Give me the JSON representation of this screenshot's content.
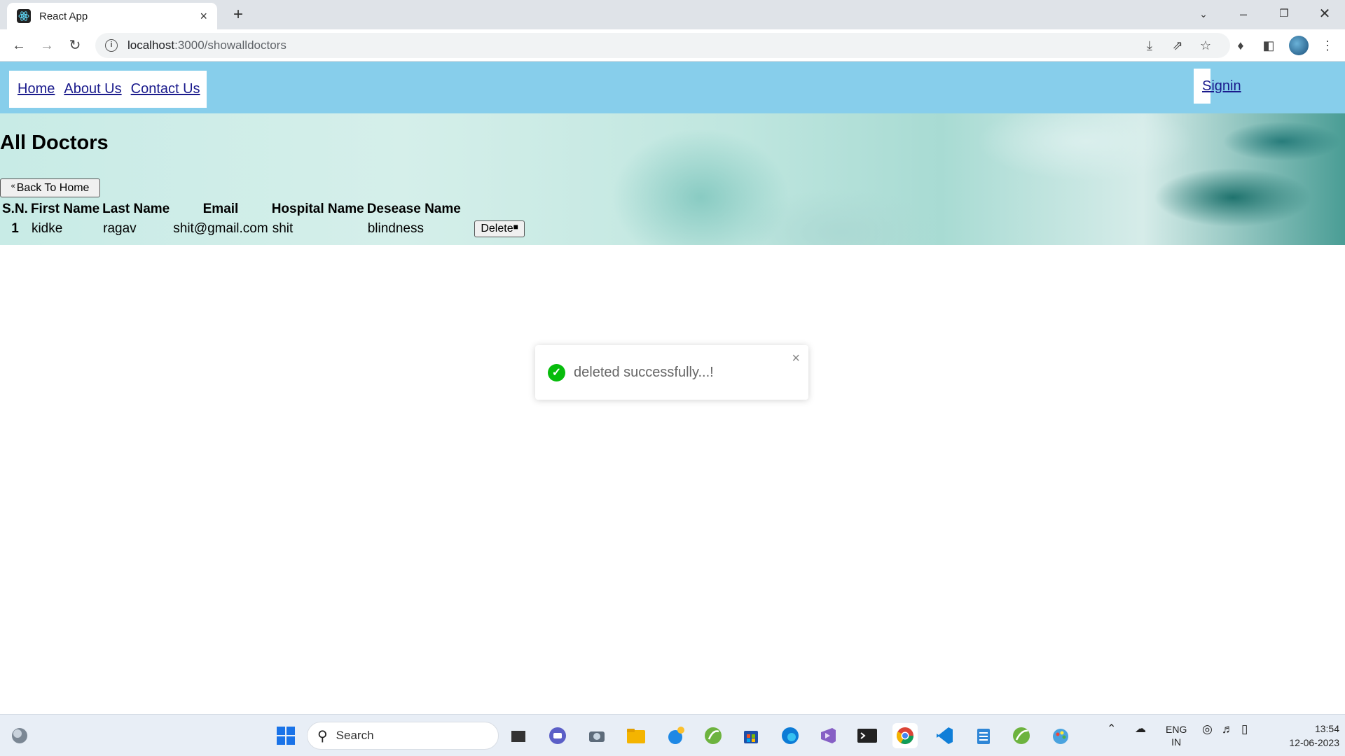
{
  "browser": {
    "tab_title": "React App",
    "tab_close": "×",
    "new_tab": "+",
    "url_host": "localhost",
    "url_path": ":3000/showalldoctors"
  },
  "nav": {
    "home": "Home",
    "about": "About Us",
    "contact": "Contact Us",
    "signin": "Signin"
  },
  "main": {
    "heading": "All Doctors",
    "back_button": "Back To Home",
    "columns": [
      "S.N.",
      "First Name",
      "Last Name",
      "Email",
      "Hospital Name",
      "Desease Name"
    ],
    "rows": [
      {
        "sn": "1",
        "first": "kidke",
        "last": "ragav",
        "email": "shit@gmail.com",
        "hospital": "shit",
        "disease": "blindness",
        "action": "Delete"
      }
    ]
  },
  "toast": {
    "message": "deleted successfully...!",
    "close": "×",
    "status_color": "#07bc0c"
  },
  "taskbar": {
    "search_placeholder": "Search",
    "lang_top": "ENG",
    "lang_bottom": "IN",
    "time": "13:54",
    "date": "12-06-2023"
  },
  "colors": {
    "nav_bg": "#87ceeb",
    "link": "#1a1a8c"
  }
}
